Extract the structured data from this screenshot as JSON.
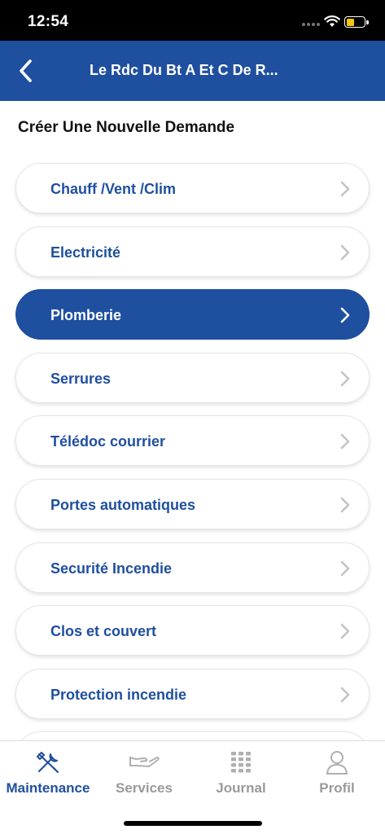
{
  "status_bar": {
    "time": "12:54",
    "battery_level": 0.45,
    "battery_color": "#f5c518"
  },
  "header": {
    "title": "Le Rdc Du Bt A Et C De R...",
    "back_icon": "chevron-left-icon"
  },
  "page": {
    "heading": "Créer Une Nouvelle Demande"
  },
  "colors": {
    "primary": "#1f4f9f",
    "inactive": "#9a9a9a"
  },
  "categories": [
    {
      "label": "Chauff /Vent /Clim",
      "selected": false
    },
    {
      "label": "Electricité",
      "selected": false
    },
    {
      "label": "Plomberie",
      "selected": true
    },
    {
      "label": "Serrures",
      "selected": false
    },
    {
      "label": "Télédoc courrier",
      "selected": false
    },
    {
      "label": "Portes automatiques",
      "selected": false
    },
    {
      "label": "Securité Incendie",
      "selected": false
    },
    {
      "label": "Clos et couvert",
      "selected": false
    },
    {
      "label": "Protection incendie",
      "selected": false
    }
  ],
  "tabs": [
    {
      "label": "Maintenance",
      "icon": "tools-icon",
      "active": true
    },
    {
      "label": "Services",
      "icon": "hand-icon",
      "active": false
    },
    {
      "label": "Journal",
      "icon": "grid-icon",
      "active": false
    },
    {
      "label": "Profil",
      "icon": "user-icon",
      "active": false
    }
  ]
}
